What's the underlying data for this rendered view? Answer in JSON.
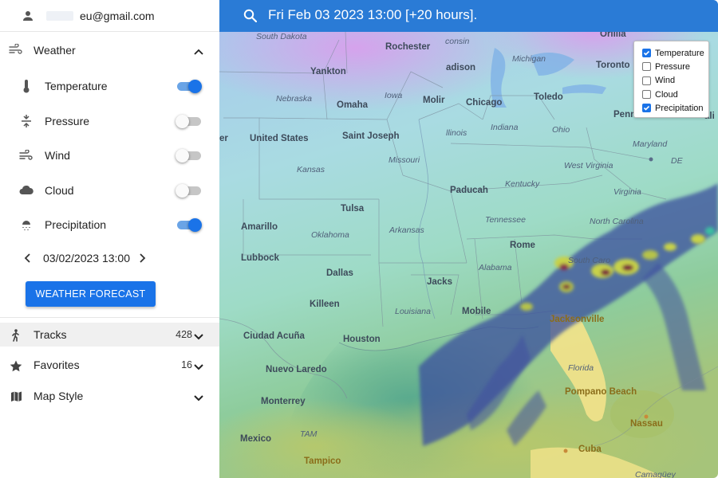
{
  "user": {
    "email": "eu@gmail.com"
  },
  "weather": {
    "title": "Weather",
    "layers": [
      {
        "label": "Temperature",
        "icon": "thermometer-icon",
        "on": true
      },
      {
        "label": "Pressure",
        "icon": "pressure-icon",
        "on": false
      },
      {
        "label": "Wind",
        "icon": "wind-icon",
        "on": false
      },
      {
        "label": "Cloud",
        "icon": "cloud-icon",
        "on": false
      },
      {
        "label": "Precipitation",
        "icon": "precipitation-icon",
        "on": true
      }
    ],
    "date": "03/02/2023 13:00",
    "forecast_button": "WEATHER FORECAST"
  },
  "sections": [
    {
      "label": "Tracks",
      "count": "428",
      "icon": "hiking-icon"
    },
    {
      "label": "Favorites",
      "count": "16",
      "icon": "star-icon"
    },
    {
      "label": "Map Style",
      "count": "",
      "icon": "map-icon"
    }
  ],
  "search": {
    "text": "Fri Feb 03 2023 13:00 [+20 hours]."
  },
  "legend": [
    {
      "label": "Temperature",
      "checked": true
    },
    {
      "label": "Pressure",
      "checked": false
    },
    {
      "label": "Wind",
      "checked": false
    },
    {
      "label": "Cloud",
      "checked": false
    },
    {
      "label": "Precipitation",
      "checked": true
    }
  ],
  "map_labels": {
    "cities": [
      "Rochester",
      "Yankton",
      "adison",
      "Toronto",
      "Orillia",
      "Omaha",
      "Molir",
      "Chicago",
      "Toledo",
      "United States",
      "Saint Joseph",
      "Paducah",
      "Tulsa",
      "Amarillo",
      "Rome",
      "Lubbock",
      "Dallas",
      "Jacks",
      "Killeen",
      "Mobile",
      "Jacksonville",
      "Ciudad Acuña",
      "Houston",
      "Nuevo Laredo",
      "Pompano Beach",
      "Monterrey",
      "Nassau",
      "Mexico",
      "Cuba",
      "Tampico",
      "Penn",
      "er",
      "ali"
    ],
    "states": [
      "South Dakota",
      "consin",
      "Michigan",
      "Nebraska",
      "Iowa",
      "llinois",
      "Indiana",
      "Ohio",
      "Maryland",
      "DE",
      "Kansas",
      "Missouri",
      "West Virginia",
      "Kentucky",
      "Virginia",
      "Tennessee",
      "North Carolina",
      "Oklahoma",
      "Arkansas",
      "Alabama",
      "South Caro",
      "Louisiana",
      "Florida",
      "TAM",
      "Camagüey"
    ]
  },
  "colors": {
    "accent": "#1a73e8",
    "search_bar": "#2a7bd6"
  }
}
